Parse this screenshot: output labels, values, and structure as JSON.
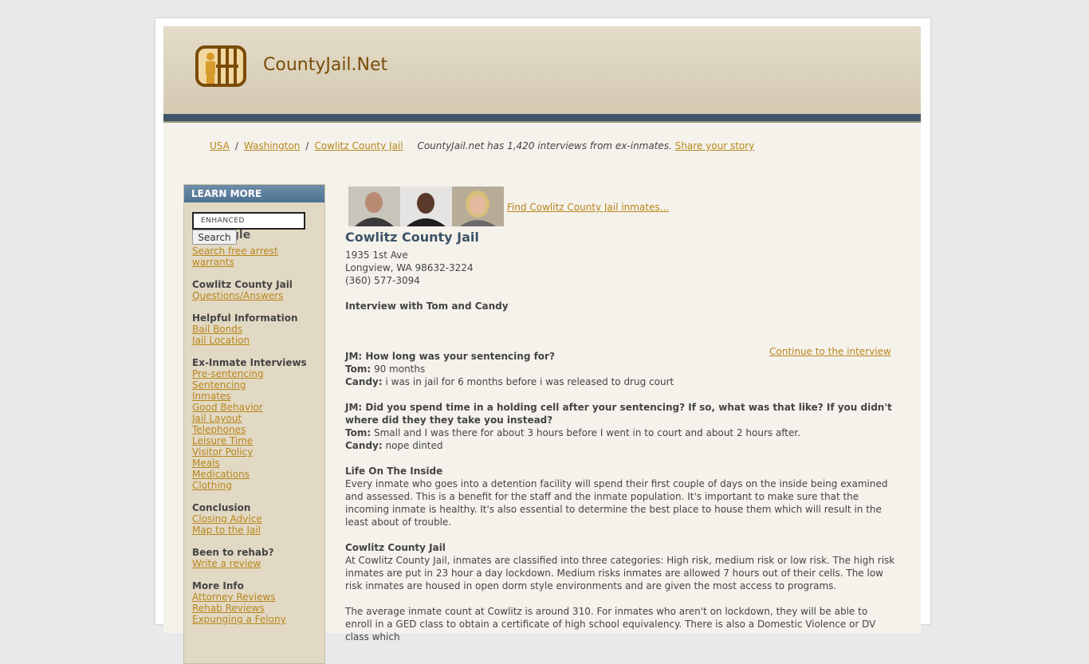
{
  "header": {
    "site_name": "CountyJail.Net",
    "logo_icon": "jail-bars-icon",
    "colors": {
      "brand": "#7a4c08",
      "accent": "#b8861b",
      "bar": "#3f5668"
    }
  },
  "breadcrumb": {
    "items": [
      "USA",
      "Washington",
      "Cowlitz County Jail"
    ],
    "separator": "/",
    "note": "CountyJail.net has 1,420 interviews from ex-inmates.",
    "share_link": "Share your story"
  },
  "sidebar": {
    "title": "LEARN MORE",
    "search_placeholder_prefix": "ENHANCED BY",
    "search_brand": "Google",
    "search_button": "Search",
    "warrants_link": "Search free arrest warrants",
    "sections": [
      {
        "head": "Cowlitz County Jail",
        "links": [
          "Questions/Answers"
        ]
      },
      {
        "head": "Helpful Information",
        "links": [
          "Bail Bonds",
          "Jail Location"
        ]
      },
      {
        "head": "Ex-Inmate Interviews",
        "links": [
          "Pre-sentencing",
          "Sentencing",
          "Inmates",
          "Good Behavior",
          "Jail Layout",
          "Telephones",
          "Leisure Time",
          "Visitor Policy",
          "Meals",
          "Medications",
          "Clothing"
        ]
      },
      {
        "head": "Conclusion",
        "links": [
          "Closing Advice",
          "Map to the Jail"
        ]
      },
      {
        "head": "Been to rehab?",
        "links": [
          "Write a review"
        ]
      },
      {
        "head": "More Info",
        "links": [
          "Attorney Reviews",
          "Rehab Reviews",
          "Expunging a Felony"
        ]
      }
    ]
  },
  "main": {
    "find_link": "Find Cowlitz County Jail inmates...",
    "jail_name": "Cowlitz County Jail",
    "address": [
      "1935 1st Ave",
      "Longview, WA 98632-3224",
      "(360) 577-3094"
    ],
    "interview_title": "Interview with Tom and Candy",
    "continue_link": "Continue to the interview",
    "q1": "JM: How long was your sentencing for?",
    "q1_tom_label": "Tom:",
    "q1_tom": " 90 months",
    "q1_candy_label": "Candy:",
    "q1_candy": " i was in jail for 6 months before i was released to drug court",
    "q2": "JM: Did you spend time in a holding cell after your sentencing? If so, what was that like? If you didn't where did they they take you instead?",
    "q2_tom_label": "Tom:",
    "q2_tom": " Small and I was there for about 3 hours before I went in to court and about 2 hours after.",
    "q2_candy_label": "Candy:",
    "q2_candy": " nope dinted",
    "life_head": "Life On The Inside",
    "life_text": "Every inmate who goes into a detention facility will spend their first couple of days on the inside being examined and assessed. This is a benefit for the staff and the inmate population. It's important to make sure that the incoming inmate is healthy. It's also essential to determine the best place to house them which will result in the least about of trouble.",
    "class_head": "Cowlitz County Jail",
    "class_text": "At Cowlitz County Jail, inmates are classified into three categories: High risk, medium risk or low risk. The high risk inmates are put in 23 hour a day lockdown. Medium risks inmates are allowed 7 hours out of their cells. The low risk inmates are housed in open dorm style environments and are given the most access to programs.",
    "count_text": "The average inmate count at Cowlitz is around 310. For inmates who aren't on lockdown, they will be able to enroll in a GED class to obtain a certificate of high school equivalency. There is also a Domestic Violence or DV class which"
  }
}
